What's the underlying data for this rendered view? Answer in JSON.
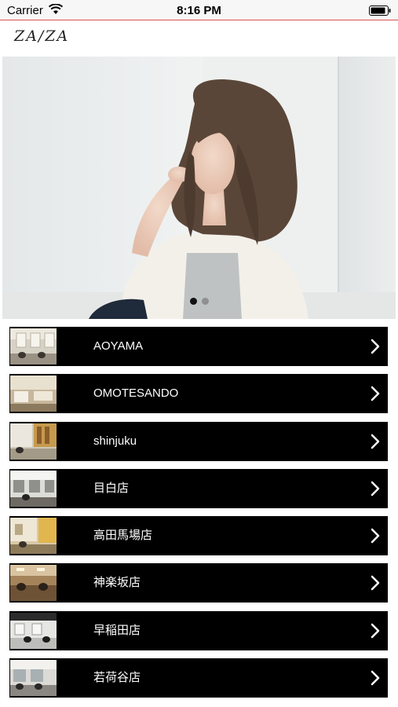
{
  "status_bar": {
    "carrier": "Carrier",
    "time": "8:16 PM",
    "icons": [
      "wifi-icon",
      "battery-icon"
    ]
  },
  "header": {
    "logo_text": "ZA/ZA"
  },
  "carousel": {
    "page_count": 2,
    "active_page": 1
  },
  "salons": [
    {
      "label": "AOYAMA"
    },
    {
      "label": "OMOTESANDO"
    },
    {
      "label": "shinjuku"
    },
    {
      "label": "目白店"
    },
    {
      "label": "高田馬場店"
    },
    {
      "label": "神楽坂店"
    },
    {
      "label": "早稲田店"
    },
    {
      "label": "若荷谷店"
    }
  ],
  "colors": {
    "row_background": "#000000",
    "row_text": "#ffffff",
    "status_divider": "#d9534f"
  }
}
